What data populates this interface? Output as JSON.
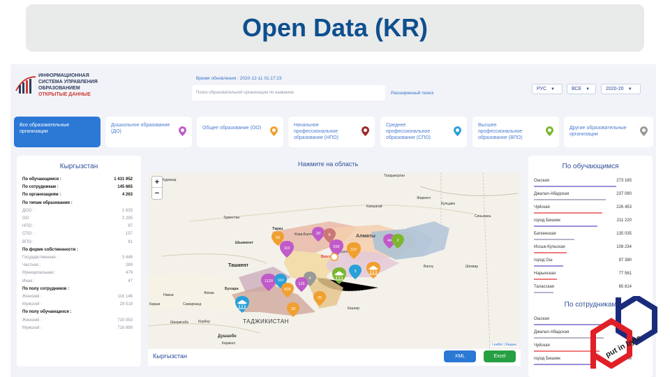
{
  "slide_title": "Open Data (KR)",
  "header": {
    "logo_lines": [
      "ИНФОРМАЦИОННАЯ",
      "СИСТЕМА УПРАВЛЕНИЯ",
      "ОБРАЗОВАНИЕМ"
    ],
    "logo_subtitle": "ОТКРЫТЫЕ ДАННЫЕ",
    "update_time": "Время обновления : 2020-12-11 01:17:23",
    "search_placeholder": "Поиск образовательной организации по названию",
    "advanced_search": "Расширенный поиск",
    "selects": {
      "language": "РУС",
      "scope": "ВСЕ",
      "year": "2020-20"
    }
  },
  "tabs": [
    {
      "label": "Все образовательные организации",
      "active": true
    },
    {
      "label": "Дошкольное образование (ДО)",
      "pin_color": "#c05ac9"
    },
    {
      "label": "Общее образование (ОО)",
      "pin_color": "#f0a030"
    },
    {
      "label": "Начальное профессиональное образование (НПО)",
      "pin_color": "#9a2a2a"
    },
    {
      "label": "Среднее профессиональное образование (СПО)",
      "pin_color": "#2aa0d8"
    },
    {
      "label": "Высшее профессиональное образование (ВПО)",
      "pin_color": "#7cb630"
    },
    {
      "label": "Другие образовательные организации",
      "pin_color": "#999999"
    }
  ],
  "left_panel": {
    "title": "Кыргызстан",
    "rows": [
      {
        "label": "По обучающимся :",
        "value": "1 431 952",
        "style": "b"
      },
      {
        "label": "По сотрудникам :",
        "value": "145 665",
        "style": "b"
      },
      {
        "label": "По организациям :",
        "value": "4 263",
        "style": "b"
      },
      {
        "label": "По типам образования :",
        "value": "",
        "style": "b"
      },
      {
        "label": "ДОО :",
        "value": "1 633",
        "style": "sub"
      },
      {
        "label": "ОО :",
        "value": "2 295",
        "style": "sub"
      },
      {
        "label": "НПО :",
        "value": "97",
        "style": "sub"
      },
      {
        "label": "СПО :",
        "value": "157",
        "style": "sub"
      },
      {
        "label": "ВПО :",
        "value": "81",
        "style": "sub"
      },
      {
        "label": "По форме собственности :",
        "value": "",
        "style": "b"
      },
      {
        "label": "Государственная :",
        "value": "3 448",
        "style": "sub"
      },
      {
        "label": "Частная :",
        "value": "289",
        "style": "sub"
      },
      {
        "label": "Муниципальная :",
        "value": "479",
        "style": "sub"
      },
      {
        "label": "Иная :",
        "value": "47",
        "style": "sub"
      },
      {
        "label": "По полу сотрудников :",
        "value": "",
        "style": "b"
      },
      {
        "label": "Женский :",
        "value": "116 146",
        "style": "sub"
      },
      {
        "label": "Мужской :",
        "value": "29 519",
        "style": "sub"
      },
      {
        "label": "По полу обучающихся :",
        "value": "",
        "style": "b"
      },
      {
        "label": "Женский :",
        "value": "715 053",
        "style": "sub"
      },
      {
        "label": "Мужской :",
        "value": "716 899",
        "style": "sub"
      }
    ]
  },
  "map": {
    "title": "Нажмите на область",
    "footer_region": "Кыргызстан",
    "xml_button": "XML",
    "excel_button": "Excel",
    "attribution": "Leaflet | Яндекс",
    "place_labels": [
      "Бишкек",
      "Ташкент",
      "Алматы",
      "Шымкент",
      "Тараз",
      "Душанбе",
      "ТАДЖИКИСТАН",
      "Самарканд",
      "Кашгар",
      "Ванчу",
      "Шохвар",
      "Капшагай",
      "Жаркент",
      "Кульджа",
      "Синьюань",
      "Талдыкорган",
      "Туркестан",
      "Кора-Балта",
      "Худжанд",
      "Навои",
      "Бухара",
      "Карши",
      "Шахрисабз",
      "Жизак",
      "Кербер",
      "Бохтар",
      "Каракол"
    ],
    "markers": [
      "50",
      "110",
      "20",
      "8",
      "200",
      "107",
      "44",
      "2",
      "4",
      "3",
      "1120",
      "110",
      "828",
      "125",
      "25",
      "28"
    ]
  },
  "right_panel": {
    "title_students": "По обучающимся",
    "students": [
      {
        "name": "Ошская",
        "value": "273 165",
        "bar": 1.0,
        "color": "#9b8fd8"
      },
      {
        "name": "Джалал-Абадская",
        "value": "237 090",
        "bar": 0.87,
        "color": "#b9b3c9"
      },
      {
        "name": "Чуйская",
        "value": "226 453",
        "bar": 0.83,
        "color": "#f07c7c"
      },
      {
        "name": "город Бишкек",
        "value": "211 220",
        "bar": 0.77,
        "color": "#9b8fd8"
      },
      {
        "name": "Баткенская",
        "value": "135 035",
        "bar": 0.49,
        "color": "#b9b3c9"
      },
      {
        "name": "Иссык-Кульская",
        "value": "108 234",
        "bar": 0.4,
        "color": "#f07c7c"
      },
      {
        "name": "город Ош",
        "value": "97 380",
        "bar": 0.36,
        "color": "#9b8fd8"
      },
      {
        "name": "Нарынская",
        "value": "77 561",
        "bar": 0.28,
        "color": "#f07c7c"
      },
      {
        "name": "Таласская",
        "value": "65 814",
        "bar": 0.24,
        "color": "#b9b3c9"
      }
    ],
    "title_staff": "По сотрудникам",
    "staff": [
      {
        "name": "Ошская",
        "value": "",
        "bar": 1.0,
        "color": "#9b8fd8"
      },
      {
        "name": "Джалал-Абадская",
        "value": "27",
        "bar": 0.85,
        "color": "#b9b3c9"
      },
      {
        "name": "Чуйская",
        "value": "",
        "bar": 0.8,
        "color": "#f07c7c"
      },
      {
        "name": "город Бишкек",
        "value": "248",
        "bar": 0.7,
        "color": "#9b8fd8"
      }
    ]
  },
  "watermark": {
    "text": "put in byte",
    "colors": {
      "red": "#e11f26",
      "blue": "#1b2b7c"
    }
  }
}
